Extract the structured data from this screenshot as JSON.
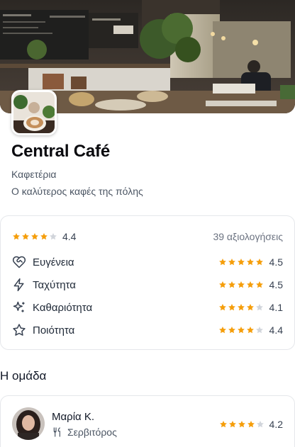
{
  "cafe": {
    "name": "Central Café",
    "category": "Καφετέρια",
    "tagline": "Ο καλύτερος καφές της πόλης",
    "cover_image": "cafe-interior-photo",
    "logo_image": "latte-cup-photo"
  },
  "ratings": {
    "overall_value": "4.4",
    "overall_stars": 4.4,
    "review_count": "39 αξιολογήσεις",
    "metrics": [
      {
        "label": "Ευγένεια",
        "value": "4.5",
        "stars": 4.5,
        "icon": "heart-handshake-icon"
      },
      {
        "label": "Ταχύτητα",
        "value": "4.5",
        "stars": 4.5,
        "icon": "lightning-icon"
      },
      {
        "label": "Καθαριότητα",
        "value": "4.1",
        "stars": 4.1,
        "icon": "sparkles-icon"
      },
      {
        "label": "Ποιότητα",
        "value": "4.4",
        "stars": 4.4,
        "icon": "star-outline-icon"
      }
    ]
  },
  "team": {
    "title": "Η ομάδα",
    "members": [
      {
        "name": "Μαρία Κ.",
        "role": "Σερβιτόρος",
        "role_icon": "fork-knife-icon",
        "value": "4.2",
        "stars": 4.2
      }
    ]
  },
  "colors": {
    "star": "#f59e0b",
    "star_empty": "#d1d5db",
    "border": "#e5e7eb"
  }
}
